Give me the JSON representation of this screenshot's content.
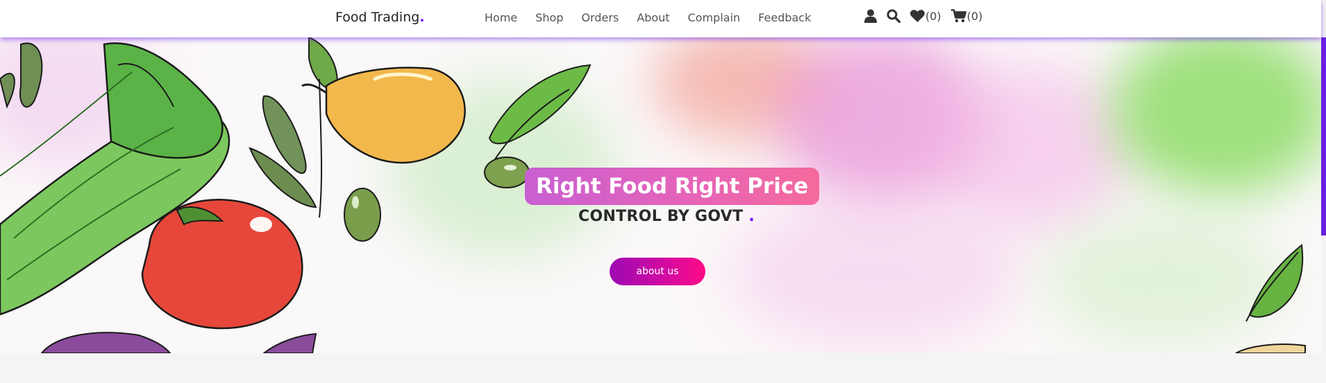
{
  "brand": {
    "name": "Food Trading",
    "dot": "."
  },
  "nav": {
    "links": [
      "Home",
      "Shop",
      "Orders",
      "About",
      "Complain",
      "Feedback"
    ]
  },
  "icons": {
    "user": "user-icon",
    "search": "search-icon",
    "wishlist": {
      "icon": "heart-icon",
      "count": "(0)"
    },
    "cart": {
      "icon": "cart-icon",
      "count": "(0)"
    }
  },
  "hero": {
    "title": "Right Food Right Price",
    "subtitle": "CONTROL BY GOVT",
    "subtitle_dot": ".",
    "button": "about us"
  },
  "colors": {
    "accent": "#6a00ff",
    "title_gradient": [
      "#c85fd2",
      "#f56a9c"
    ],
    "button_gradient": [
      "#9d0ab2",
      "#ff0a86"
    ]
  }
}
